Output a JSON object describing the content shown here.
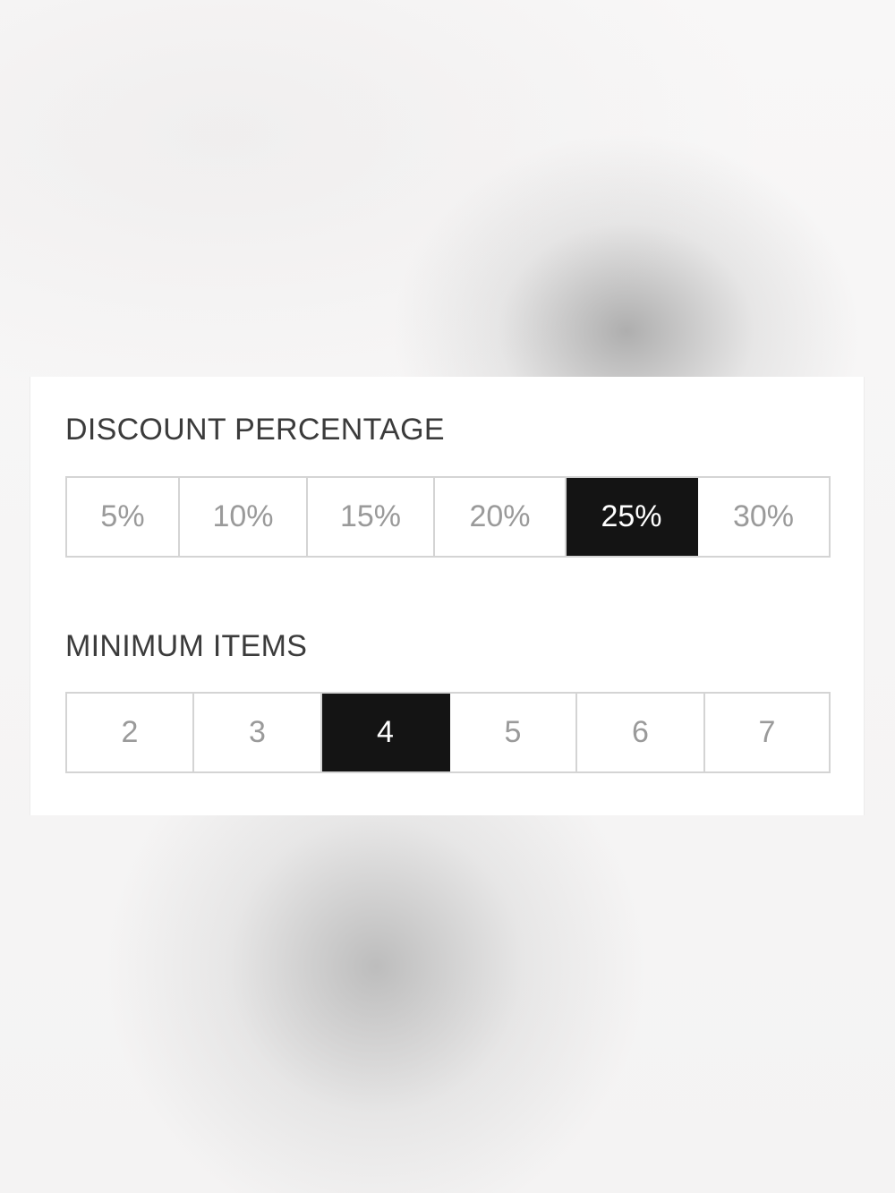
{
  "discount": {
    "title": "DISCOUNT PERCENTAGE",
    "options": [
      "5%",
      "10%",
      "15%",
      "20%",
      "25%",
      "30%"
    ],
    "selected": "25%"
  },
  "minimum_items": {
    "title": "MINIMUM ITEMS",
    "options": [
      "2",
      "3",
      "4",
      "5",
      "6",
      "7"
    ],
    "selected": "4"
  },
  "colors": {
    "selected_background": "#141414",
    "selected_text": "#ffffff",
    "option_text": "#9a9a9a",
    "border": "#d4d4d4",
    "title_text": "#3b3b3b"
  }
}
